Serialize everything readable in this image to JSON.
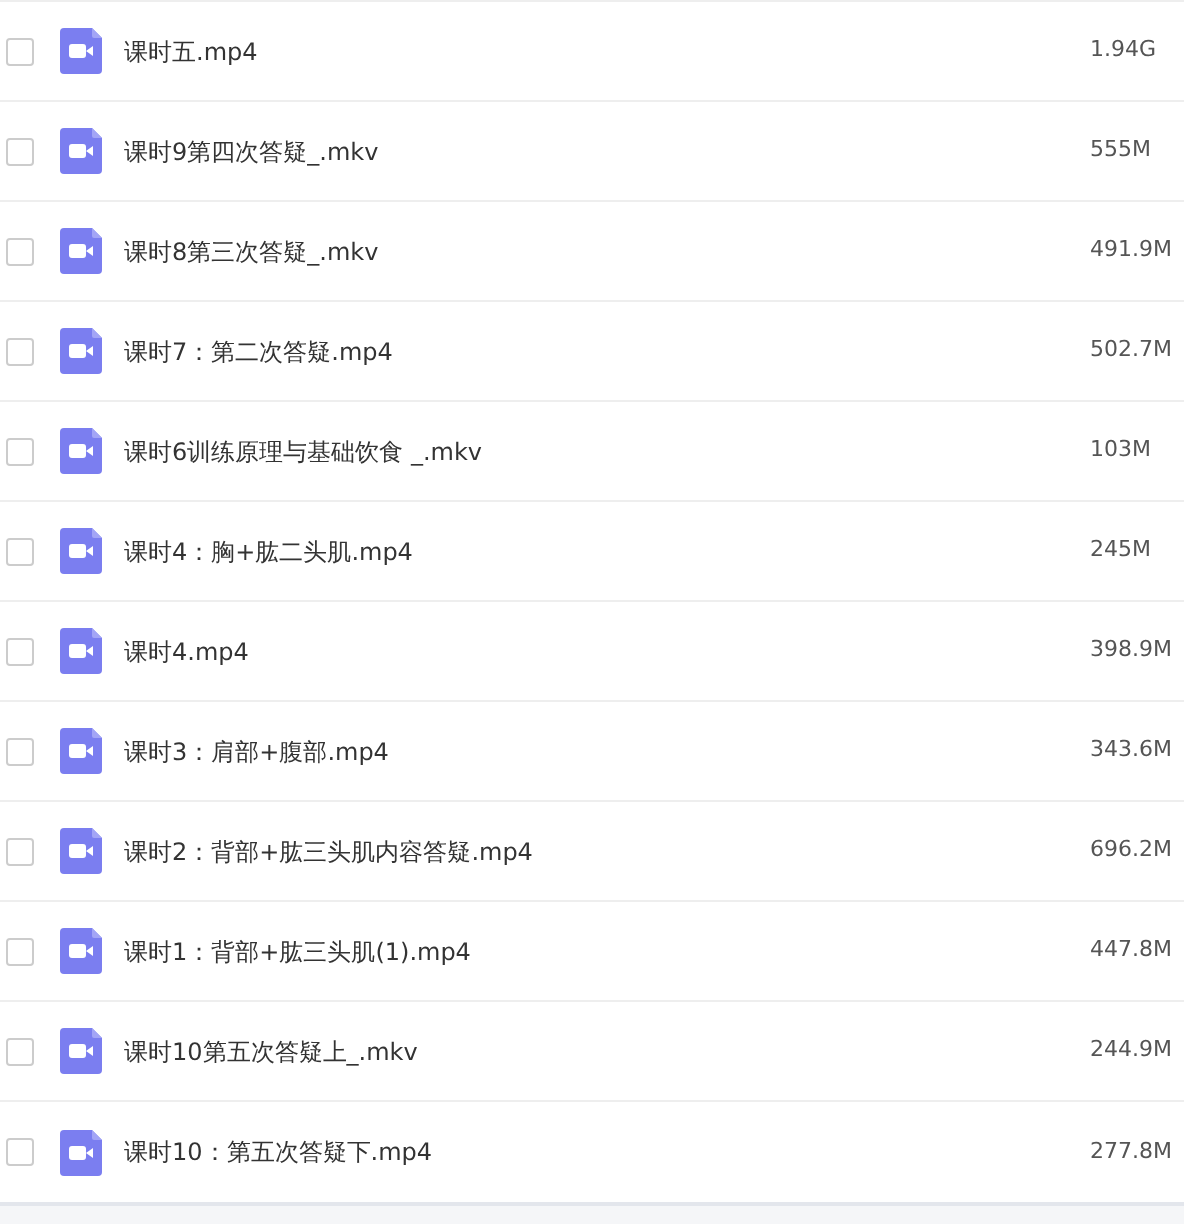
{
  "files": [
    {
      "name": "课时五.mp4",
      "size": "1.94G",
      "checked": false
    },
    {
      "name": "课时9第四次答疑_.mkv",
      "size": "555M",
      "checked": false
    },
    {
      "name": "课时8第三次答疑_.mkv",
      "size": "491.9M",
      "checked": false
    },
    {
      "name": "课时7：第二次答疑.mp4",
      "size": "502.7M",
      "checked": false
    },
    {
      "name": "课时6训练原理与基础饮食 _.mkv",
      "size": "103M",
      "checked": false
    },
    {
      "name": "课时4：胸+肱二头肌.mp4",
      "size": "245M",
      "checked": false
    },
    {
      "name": "课时4.mp4",
      "size": "398.9M",
      "checked": false
    },
    {
      "name": "课时3：肩部+腹部.mp4",
      "size": "343.6M",
      "checked": false
    },
    {
      "name": "课时2：背部+肱三头肌内容答疑.mp4",
      "size": "696.2M",
      "checked": false
    },
    {
      "name": "课时1：背部+肱三头肌(1).mp4",
      "size": "447.8M",
      "checked": false
    },
    {
      "name": "课时10第五次答疑上_.mkv",
      "size": "244.9M",
      "checked": false
    },
    {
      "name": "课时10：第五次答疑下.mp4",
      "size": "277.8M",
      "checked": false
    }
  ]
}
